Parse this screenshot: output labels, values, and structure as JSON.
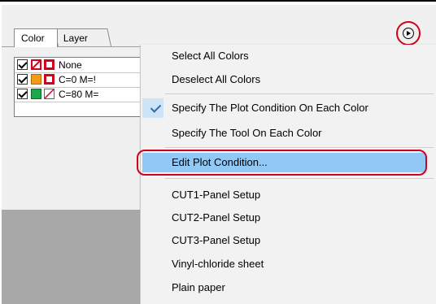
{
  "tabs": [
    {
      "label": "Color"
    },
    {
      "label": "Layer"
    }
  ],
  "colors": [
    {
      "label": "None",
      "checked": true,
      "fill": "#ffffff"
    },
    {
      "label": "C=0 M=!",
      "checked": true,
      "fill": "#f29b1a"
    },
    {
      "label": "C=80 M=",
      "checked": true,
      "fill": "#1fa54a"
    }
  ],
  "menu": {
    "items": [
      {
        "label": "Select All Colors"
      },
      {
        "label": "Deselect All Colors"
      },
      {
        "label": "Specify The Plot Condition On Each Color",
        "checked": true
      },
      {
        "label": "Specify The Tool On Each Color"
      },
      {
        "label": "Edit Plot Condition...",
        "highlighted": true
      },
      {
        "label": "CUT1-Panel Setup"
      },
      {
        "label": "CUT2-Panel Setup"
      },
      {
        "label": "CUT3-Panel Setup"
      },
      {
        "label": "Vinyl-chloride sheet"
      },
      {
        "label": "Plain paper"
      }
    ]
  },
  "icons": {
    "panel_menu_button": "play-circle-icon"
  },
  "colors_theme": {
    "highlight": "#90c8f6",
    "annotation_ring": "#d0021b",
    "check": "#2b6cb0"
  }
}
